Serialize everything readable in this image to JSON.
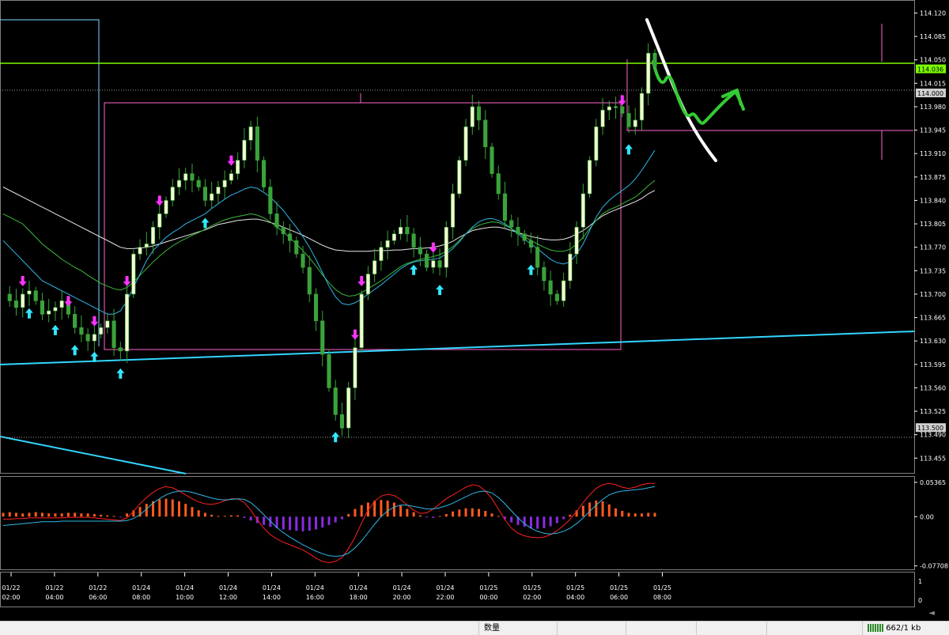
{
  "chart_data": [
    {
      "type": "candlestick",
      "symbol_pane": "price",
      "ylim": [
        113.44,
        114.13
      ],
      "y_ticks": [
        "114.120",
        "114.085",
        "114.050",
        "114.015",
        "113.980",
        "113.945",
        "113.910",
        "113.875",
        "113.840",
        "113.805",
        "113.770",
        "113.735",
        "113.700",
        "113.665",
        "113.630",
        "113.595",
        "113.560",
        "113.525",
        "113.490",
        "113.455"
      ],
      "price_labels": [
        {
          "value": 114.036,
          "text": "114.036",
          "color": "#7cfc00"
        },
        {
          "value": 114.0,
          "text": "114.000",
          "color": "#cfcfcf"
        },
        {
          "value": 113.5,
          "text": "113.500",
          "color": "#cfcfcf"
        }
      ],
      "x_ticks": [
        {
          "date": "01/22",
          "time": "02:00"
        },
        {
          "date": "01/22",
          "time": "04:00"
        },
        {
          "date": "01/22",
          "time": "06:00"
        },
        {
          "date": "01/24",
          "time": "08:00"
        },
        {
          "date": "01/24",
          "time": "10:00"
        },
        {
          "date": "01/24",
          "time": "12:00"
        },
        {
          "date": "01/24",
          "time": "14:00"
        },
        {
          "date": "01/24",
          "time": "16:00"
        },
        {
          "date": "01/24",
          "time": "18:00"
        },
        {
          "date": "01/24",
          "time": "20:00"
        },
        {
          "date": "01/24",
          "time": "22:00"
        },
        {
          "date": "01/25",
          "time": "00:00"
        },
        {
          "date": "01/25",
          "time": "02:00"
        },
        {
          "date": "01/25",
          "time": "04:00"
        },
        {
          "date": "01/25",
          "time": "06:00"
        },
        {
          "date": "01/25",
          "time": "08:00"
        }
      ],
      "close_path": [
        113.7,
        113.69,
        113.68,
        113.7,
        113.705,
        113.69,
        113.67,
        113.675,
        113.68,
        113.69,
        113.67,
        113.65,
        113.64,
        113.63,
        113.64,
        113.65,
        113.66,
        113.62,
        113.615,
        113.7,
        113.76,
        113.77,
        113.775,
        113.8,
        113.82,
        113.84,
        113.86,
        113.87,
        113.88,
        113.87,
        113.86,
        113.84,
        113.85,
        113.86,
        113.87,
        113.88,
        113.9,
        113.93,
        113.95,
        113.9,
        113.86,
        113.82,
        113.8,
        113.79,
        113.78,
        113.76,
        113.74,
        113.7,
        113.66,
        113.61,
        113.56,
        113.52,
        113.5,
        113.56,
        113.62,
        113.7,
        113.73,
        113.75,
        113.77,
        113.78,
        113.79,
        113.8,
        113.79,
        113.77,
        113.76,
        113.74,
        113.75,
        113.74,
        113.8,
        113.85,
        113.9,
        113.95,
        113.98,
        113.96,
        113.92,
        113.88,
        113.85,
        113.81,
        113.8,
        113.79,
        113.78,
        113.77,
        113.74,
        113.72,
        113.7,
        113.69,
        113.72,
        113.76,
        113.8,
        113.85,
        113.9,
        113.95,
        113.975,
        113.98,
        113.98,
        113.97,
        113.95,
        113.96,
        114.0,
        114.06,
        114.04
      ],
      "ma_white": [
        113.86,
        113.855,
        113.85,
        113.845,
        113.84,
        113.835,
        113.83,
        113.825,
        113.82,
        113.815,
        113.81,
        113.805,
        113.8,
        113.795,
        113.79,
        113.785,
        113.78,
        113.775,
        113.77,
        113.768,
        113.768,
        113.769,
        113.77,
        113.772,
        113.775,
        113.778,
        113.781,
        113.784,
        113.787,
        113.79,
        113.793,
        113.796,
        113.8,
        113.804,
        113.806,
        113.808,
        113.81,
        113.811,
        113.812,
        113.812,
        113.81,
        113.807,
        113.804,
        113.8,
        113.796,
        113.792,
        113.788,
        113.783,
        113.778,
        113.773,
        113.769,
        113.766,
        113.765,
        113.764,
        113.764,
        113.764,
        113.764,
        113.765,
        113.765,
        113.765,
        113.766,
        113.766,
        113.767,
        113.768,
        113.768,
        113.769,
        113.77,
        113.772,
        113.775,
        113.779,
        113.785,
        113.79,
        113.795,
        113.797,
        113.799,
        113.8,
        113.8,
        113.798,
        113.795,
        113.792,
        113.789,
        113.786,
        113.784,
        113.782,
        113.781,
        113.781,
        113.782,
        113.785,
        113.79,
        113.795,
        113.802,
        113.81,
        113.817,
        113.822,
        113.826,
        113.83,
        113.834,
        113.838,
        113.843,
        113.85,
        113.855
      ],
      "ma_cyan": [
        113.78,
        113.77,
        113.76,
        113.75,
        113.74,
        113.73,
        113.72,
        113.715,
        113.71,
        113.705,
        113.7,
        113.695,
        113.69,
        113.685,
        113.68,
        113.675,
        113.67,
        113.67,
        113.675,
        113.69,
        113.71,
        113.73,
        113.75,
        113.765,
        113.775,
        113.785,
        113.792,
        113.798,
        113.805,
        113.81,
        113.815,
        113.82,
        113.828,
        113.835,
        113.842,
        113.848,
        113.852,
        113.857,
        113.86,
        113.858,
        113.852,
        113.845,
        113.835,
        113.825,
        113.812,
        113.8,
        113.786,
        113.77,
        113.752,
        113.732,
        113.712,
        113.696,
        113.686,
        113.684,
        113.687,
        113.693,
        113.7,
        113.707,
        113.714,
        113.722,
        113.73,
        113.738,
        113.744,
        113.748,
        113.75,
        113.751,
        113.752,
        113.754,
        113.76,
        113.768,
        113.778,
        113.79,
        113.8,
        113.808,
        113.812,
        113.813,
        113.81,
        113.805,
        113.798,
        113.79,
        113.782,
        113.775,
        113.768,
        113.76,
        113.752,
        113.747,
        113.745,
        113.748,
        113.76,
        113.775,
        113.795,
        113.815,
        113.83,
        113.84,
        113.848,
        113.855,
        113.862,
        113.872,
        113.885,
        113.9,
        113.915
      ],
      "ma_green": [
        113.82,
        113.815,
        113.81,
        113.805,
        113.795,
        113.785,
        113.775,
        113.767,
        113.76,
        113.752,
        113.746,
        113.74,
        113.735,
        113.728,
        113.722,
        113.716,
        113.712,
        113.708,
        113.706,
        113.71,
        113.718,
        113.728,
        113.738,
        113.748,
        113.757,
        113.765,
        113.772,
        113.778,
        113.783,
        113.788,
        113.792,
        113.797,
        113.802,
        113.807,
        113.811,
        113.814,
        113.816,
        113.818,
        113.82,
        113.818,
        113.814,
        113.808,
        113.8,
        113.793,
        113.784,
        113.775,
        113.765,
        113.754,
        113.742,
        113.729,
        113.717,
        113.707,
        113.7,
        113.697,
        113.698,
        113.702,
        113.708,
        113.714,
        113.72,
        113.727,
        113.734,
        113.741,
        113.746,
        113.749,
        113.752,
        113.754,
        113.756,
        113.759,
        113.764,
        113.771,
        113.78,
        113.79,
        113.798,
        113.803,
        113.806,
        113.808,
        113.807,
        113.803,
        113.798,
        113.792,
        113.786,
        113.78,
        113.775,
        113.77,
        113.766,
        113.764,
        113.764,
        113.767,
        113.775,
        113.785,
        113.798,
        113.81,
        113.82,
        113.826,
        113.83,
        113.835,
        113.84,
        113.845,
        113.853,
        113.862,
        113.87
      ],
      "support_lines": [
        {
          "name": "horizontal-green-line",
          "value": 114.036,
          "color": "#7cfc00"
        },
        {
          "name": "horizontal-dotted-line",
          "value": 114.0,
          "color": "#9a9a9a"
        },
        {
          "name": "horizontal-dotted-line",
          "value": 113.5,
          "color": "#9a9a9a"
        }
      ],
      "grid": false
    },
    {
      "type": "macd",
      "symbol_pane": "oscillator",
      "ylim": [
        -0.0775,
        0.0585
      ],
      "y_ticks": [
        "0.05365",
        "0.00",
        "-0.07708"
      ],
      "histogram": [
        0.006,
        0.007,
        0.006,
        0.005,
        0.006,
        0.007,
        0.006,
        0.005,
        0.005,
        0.005,
        0.006,
        0.006,
        0.005,
        0.005,
        0.004,
        0.003,
        0.002,
        0.001,
        -0.001,
        0.005,
        0.01,
        0.015,
        0.02,
        0.024,
        0.027,
        0.028,
        0.027,
        0.024,
        0.02,
        0.015,
        0.01,
        0.006,
        0.003,
        0.001,
        0.001,
        0.002,
        0.002,
        -0.002,
        -0.006,
        -0.01,
        -0.013,
        -0.016,
        -0.018,
        -0.02,
        -0.021,
        -0.022,
        -0.023,
        -0.022,
        -0.02,
        -0.017,
        -0.013,
        -0.009,
        -0.004,
        0.004,
        0.012,
        0.018,
        0.022,
        0.025,
        0.026,
        0.025,
        0.022,
        0.017,
        0.012,
        0.007,
        0.002,
        -0.001,
        -0.002,
        0.001,
        0.004,
        0.008,
        0.011,
        0.013,
        0.013,
        0.012,
        0.009,
        0.005,
        0.001,
        -0.004,
        -0.009,
        -0.013,
        -0.016,
        -0.018,
        -0.019,
        -0.018,
        -0.015,
        -0.01,
        -0.004,
        0.003,
        0.01,
        0.017,
        0.022,
        0.025,
        0.024,
        0.019,
        0.013,
        0.009,
        0.006,
        0.005,
        0.005,
        0.006,
        0.006
      ],
      "signal_red": [
        -0.004,
        -0.004,
        -0.003,
        -0.003,
        -0.002,
        -0.002,
        -0.002,
        -0.002,
        -0.002,
        -0.002,
        -0.001,
        -0.001,
        -0.001,
        -0.001,
        -0.002,
        -0.003,
        -0.004,
        -0.005,
        -0.006,
        -0.002,
        0.008,
        0.02,
        0.03,
        0.038,
        0.044,
        0.047,
        0.045,
        0.04,
        0.034,
        0.028,
        0.023,
        0.02,
        0.019,
        0.021,
        0.025,
        0.028,
        0.028,
        0.022,
        0.01,
        -0.005,
        -0.018,
        -0.028,
        -0.035,
        -0.04,
        -0.044,
        -0.048,
        -0.052,
        -0.058,
        -0.065,
        -0.07,
        -0.072,
        -0.07,
        -0.064,
        -0.05,
        -0.032,
        -0.01,
        0.01,
        0.024,
        0.032,
        0.035,
        0.033,
        0.027,
        0.018,
        0.01,
        0.005,
        0.006,
        0.012,
        0.02,
        0.028,
        0.034,
        0.04,
        0.046,
        0.05,
        0.048,
        0.04,
        0.028,
        0.012,
        -0.005,
        -0.018,
        -0.026,
        -0.03,
        -0.032,
        -0.033,
        -0.032,
        -0.028,
        -0.022,
        -0.014,
        -0.004,
        0.008,
        0.022,
        0.034,
        0.044,
        0.05,
        0.052,
        0.05,
        0.046,
        0.044,
        0.046,
        0.05,
        0.052,
        0.052
      ],
      "main_cyan": [
        -0.014,
        -0.013,
        -0.012,
        -0.011,
        -0.01,
        -0.009,
        -0.008,
        -0.008,
        -0.008,
        -0.007,
        -0.007,
        -0.007,
        -0.007,
        -0.007,
        -0.007,
        -0.007,
        -0.007,
        -0.007,
        -0.007,
        -0.006,
        -0.003,
        0.003,
        0.012,
        0.021,
        0.028,
        0.034,
        0.038,
        0.04,
        0.04,
        0.038,
        0.035,
        0.032,
        0.029,
        0.027,
        0.026,
        0.027,
        0.028,
        0.027,
        0.022,
        0.013,
        0.003,
        -0.007,
        -0.017,
        -0.025,
        -0.032,
        -0.038,
        -0.044,
        -0.049,
        -0.054,
        -0.058,
        -0.061,
        -0.062,
        -0.061,
        -0.057,
        -0.049,
        -0.038,
        -0.025,
        -0.012,
        0.0,
        0.009,
        0.015,
        0.018,
        0.018,
        0.016,
        0.014,
        0.012,
        0.012,
        0.014,
        0.017,
        0.021,
        0.026,
        0.031,
        0.036,
        0.039,
        0.04,
        0.037,
        0.03,
        0.02,
        0.009,
        -0.002,
        -0.011,
        -0.018,
        -0.023,
        -0.026,
        -0.027,
        -0.026,
        -0.023,
        -0.018,
        -0.011,
        -0.002,
        0.008,
        0.018,
        0.027,
        0.034,
        0.038,
        0.04,
        0.041,
        0.042,
        0.043,
        0.045,
        0.047
      ]
    }
  ],
  "statusbar": {
    "quantity_label": "数量",
    "traffic": "662/1 kb"
  }
}
